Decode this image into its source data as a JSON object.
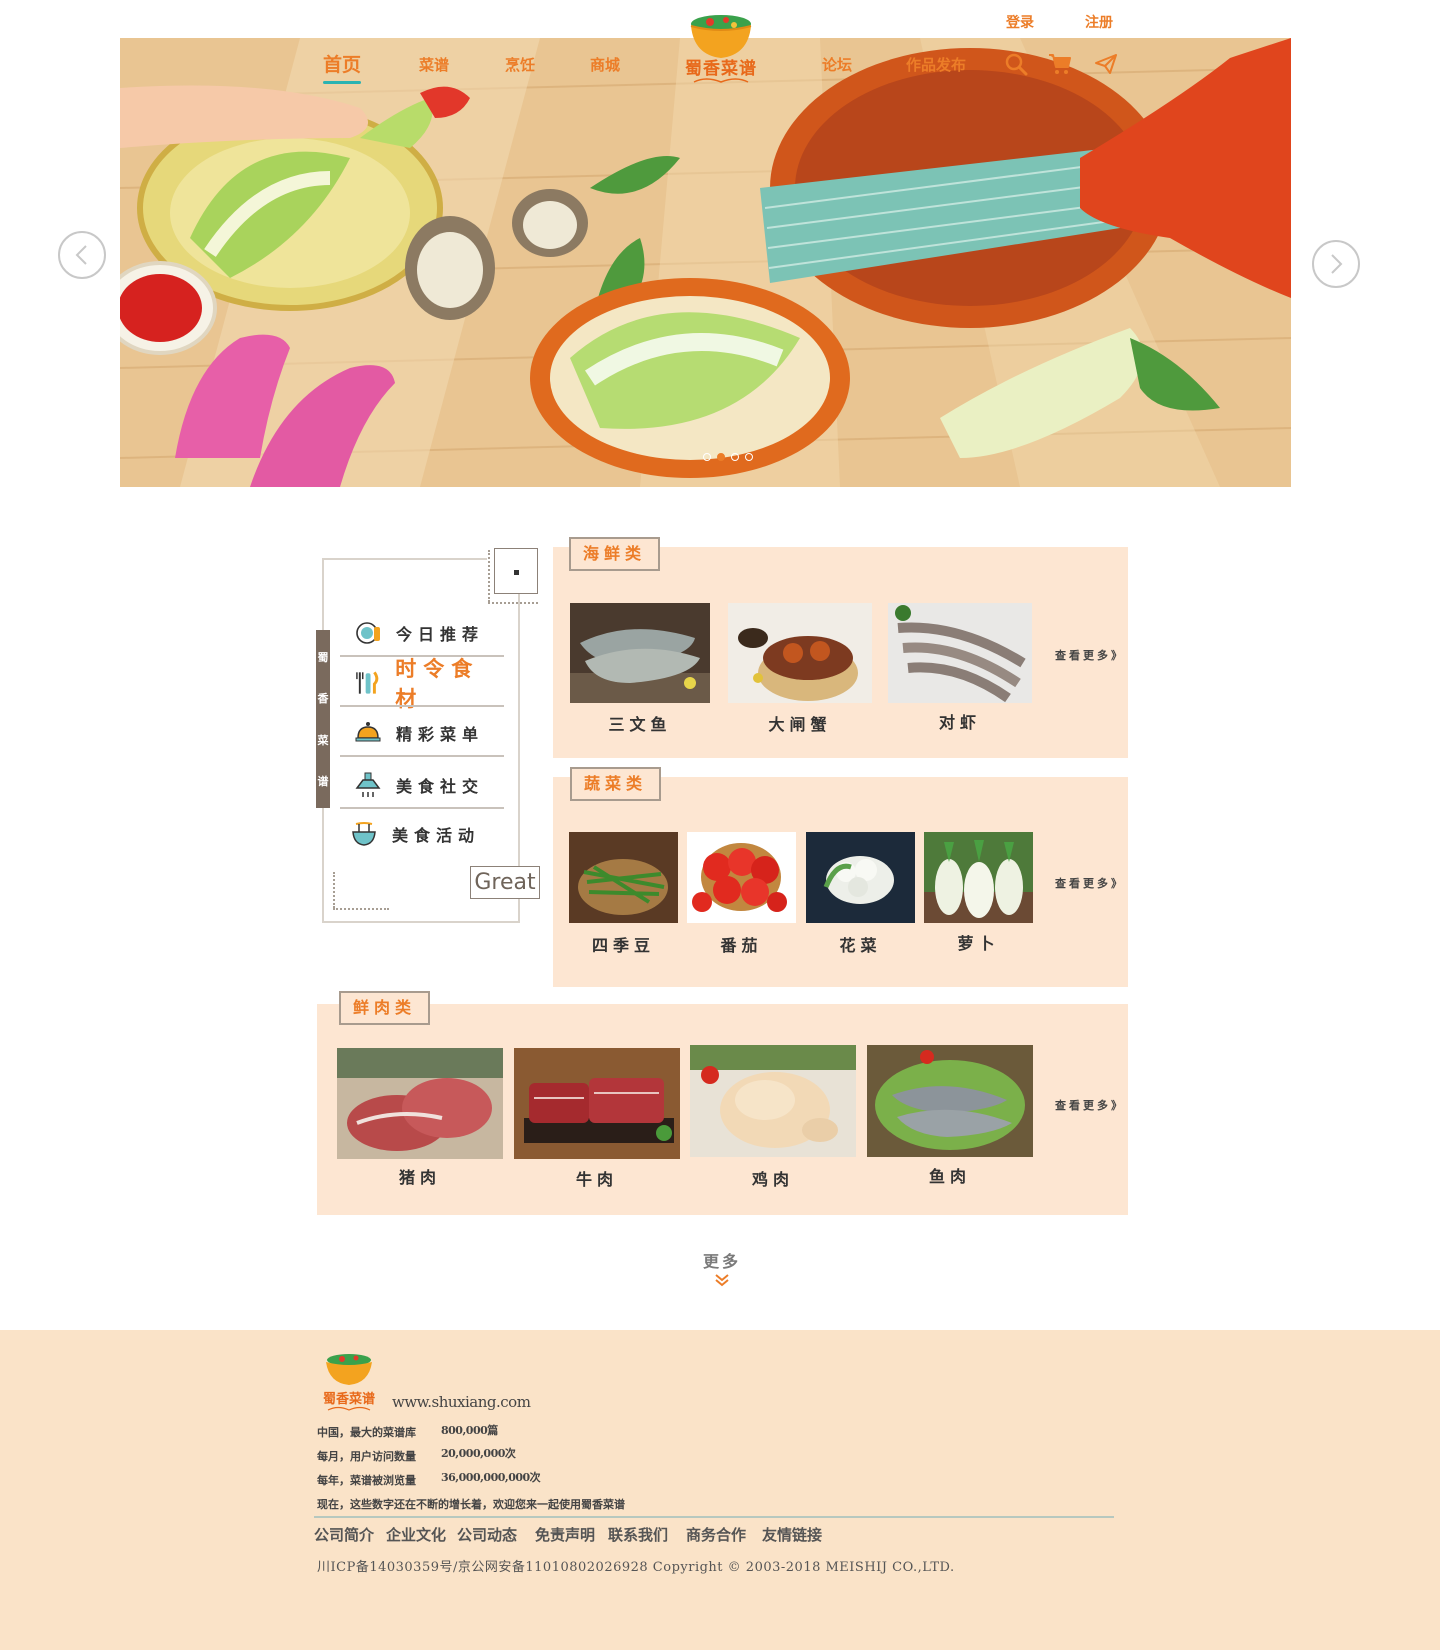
{
  "auth": {
    "login": "登录",
    "register": "注册"
  },
  "logo": {
    "text": "蜀香菜谱"
  },
  "nav": {
    "home": "首页",
    "recipes": "菜谱",
    "cooking": "烹饪",
    "mall": "商城",
    "forum": "论坛",
    "publish": "作品发布"
  },
  "icons": [
    "search-icon",
    "cart-icon",
    "send-icon"
  ],
  "carousel": {
    "total": 4,
    "active": 2
  },
  "sidebar": {
    "vertical_label": [
      "蜀",
      "香",
      "菜",
      "谱"
    ],
    "items": [
      {
        "label": "今日推荐",
        "icon": "plate-icon"
      },
      {
        "label": "时令食材",
        "icon": "utensils-icon"
      },
      {
        "label": "精彩菜单",
        "icon": "cloche-icon"
      },
      {
        "label": "美食社交",
        "icon": "hood-icon"
      },
      {
        "label": "美食活动",
        "icon": "bowl-icon"
      }
    ],
    "active_index": 1,
    "badge": "Great"
  },
  "seafood": {
    "title": "海鲜类",
    "more": "查看更多》",
    "items": [
      "三文鱼",
      "大闸蟹",
      "对虾"
    ]
  },
  "vegetables": {
    "title": "蔬菜类",
    "more": "查看更多》",
    "items": [
      "四季豆",
      "番茄",
      "花菜",
      "萝卜"
    ]
  },
  "meat": {
    "title": "鲜肉类",
    "more": "查看更多》",
    "items": [
      "猪肉",
      "牛肉",
      "鸡肉",
      "鱼肉"
    ]
  },
  "more_button": "更多",
  "footer": {
    "logo_text": "蜀香菜谱",
    "url": "www.shuxiang.com",
    "stats": [
      {
        "label": "中国，最大的菜谱库",
        "value": "800,000篇"
      },
      {
        "label": "每月，用户访问数量",
        "value": "20,000,000次"
      },
      {
        "label": "每年，菜谱被浏览量",
        "value": "36,000,000,000次"
      }
    ],
    "note": "现在，这些数字还在不断的增长着，欢迎您来一起使用蜀香菜谱",
    "links": [
      "公司简介",
      "企业文化",
      "公司动态",
      "免责声明",
      "联系我们",
      "商务合作",
      "友情链接"
    ],
    "copyright": "川ICP备14030359号/京公网安备11010802026928 Copyright © 2003-2018 MEISHIJ CO.,LTD."
  },
  "colors": {
    "accent": "#ec7d28",
    "panel": "#fde6d2",
    "footer": "#fae3c8",
    "teal": "#2ab3b2"
  }
}
